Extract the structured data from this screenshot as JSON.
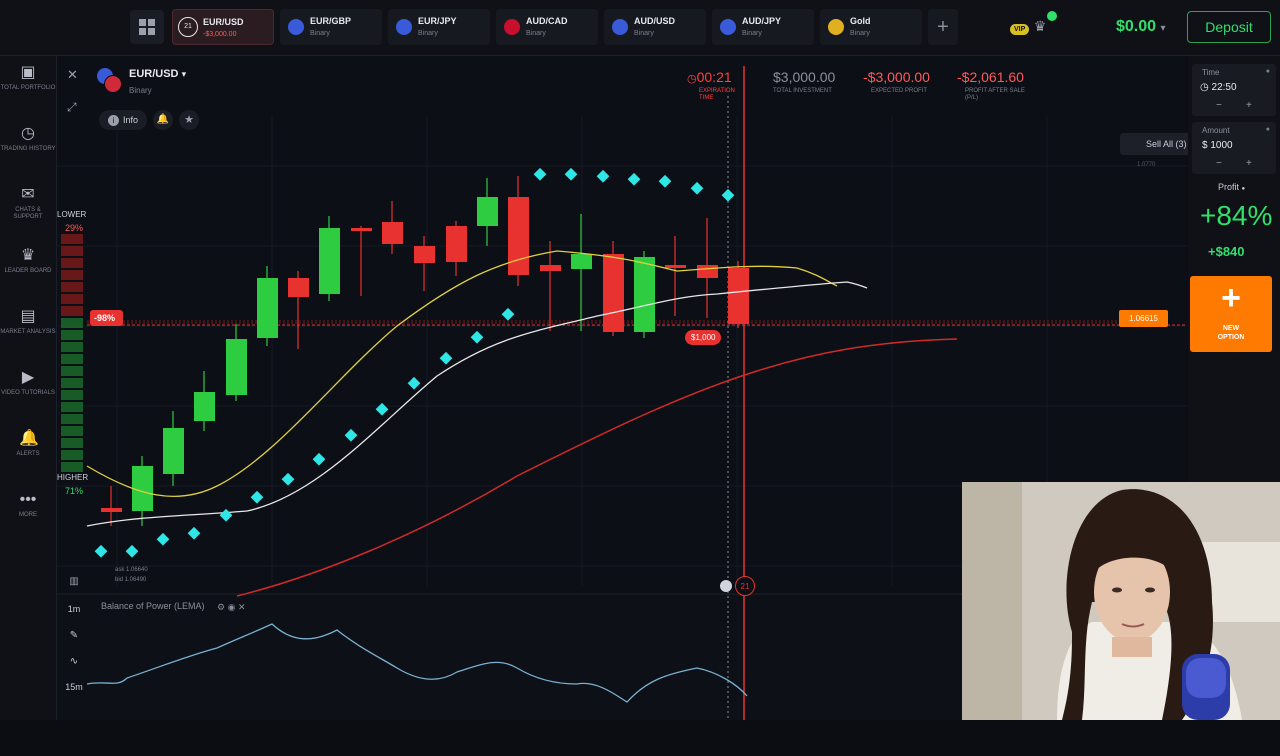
{
  "tabs": [
    {
      "name": "EUR/USD",
      "sub": "-$3,000.00",
      "badge": "21",
      "active": true,
      "flag_color": "#3a5bd9"
    },
    {
      "name": "EUR/GBP",
      "sub": "Binary",
      "active": false,
      "flag_color": "#3a5bd9"
    },
    {
      "name": "EUR/JPY",
      "sub": "Binary",
      "active": false,
      "flag_color": "#3a5bd9"
    },
    {
      "name": "AUD/CAD",
      "sub": "Binary",
      "active": false,
      "flag_color": "#c8102e"
    },
    {
      "name": "AUD/USD",
      "sub": "Binary",
      "active": false,
      "flag_color": "#3a5bd9"
    },
    {
      "name": "AUD/JPY",
      "sub": "Binary",
      "active": false,
      "flag_color": "#3a5bd9"
    },
    {
      "name": "Gold",
      "sub": "Binary",
      "active": false,
      "flag_color": "#e0b020"
    }
  ],
  "header": {
    "balance": "$0.00",
    "deposit": "Deposit",
    "vip": "VIP"
  },
  "sidebar": [
    {
      "label": "TOTAL PORTFOLIO",
      "icon": "portfolio-icon",
      "glyph": "▣"
    },
    {
      "label": "TRADING HISTORY",
      "icon": "history-icon",
      "glyph": "◷"
    },
    {
      "label": "CHATS & SUPPORT",
      "icon": "chat-icon",
      "glyph": "✉"
    },
    {
      "label": "LEADER BOARD",
      "icon": "leaderboard-icon",
      "glyph": "♛"
    },
    {
      "label": "MARKET ANALYSIS",
      "icon": "market-analysis-icon",
      "glyph": "▤"
    },
    {
      "label": "VIDEO TUTORIALS",
      "icon": "video-icon",
      "glyph": "▶"
    },
    {
      "label": "ALERTS",
      "icon": "bell-icon",
      "glyph": "🔔"
    },
    {
      "label": "MORE",
      "icon": "more-icon",
      "glyph": "•••"
    }
  ],
  "asset": {
    "name": "EUR/USD",
    "type": "Binary",
    "info": "Info"
  },
  "stats": {
    "expiration": "00:21",
    "expiration_cap": "EXPIRATION TIME",
    "investment": "$3,000.00",
    "investment_cap": "TOTAL INVESTMENT",
    "expected": "-$3,000.00",
    "expected_cap": "EXPECTED PROFIT",
    "pnl": "-$2,061.60",
    "pnl_cap": "PROFIT AFTER SALE (P/L)"
  },
  "sell_all": "Sell All (3)",
  "right": {
    "time_label": "Time",
    "time_value": "22:50",
    "amount_label": "Amount",
    "amount_value": "$ 1000",
    "profit_label": "Profit",
    "profit_pct": "+84%",
    "profit_amt": "+$840",
    "new_option": "NEW OPTION"
  },
  "chart": {
    "lower_label": "LOWER",
    "lower_pct": "29%",
    "higher_label": "HIGHER",
    "higher_pct": "71%",
    "pos_tag": "-98%",
    "deal_tag": "$1,000",
    "price_tag": "1.06615",
    "ask": "ask 1.06640",
    "bid": "bid 1.06490",
    "indicator": "Balance of Power (LEMA)",
    "timeframe_1": "1m",
    "timeframe_2": "15m",
    "timer_badge": "21",
    "price_axis_top": "1.0770"
  },
  "colors": {
    "up": "#2ecc40",
    "down": "#e8322f",
    "accent": "#ff7a00",
    "profit": "#2fe06a"
  }
}
